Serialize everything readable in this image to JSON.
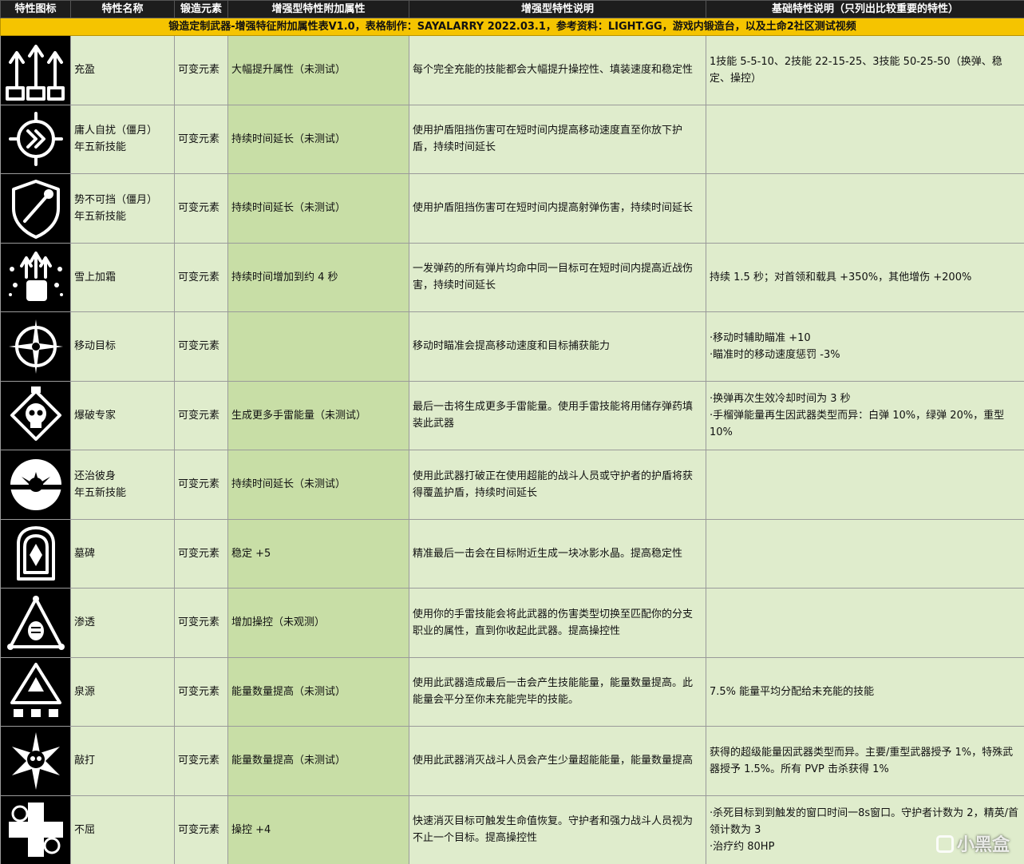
{
  "headers": [
    "特性图标",
    "特性名称",
    "锻造元素",
    "增强型特性附加属性",
    "增强型特性说明",
    "基础特性说明（只列出比较重要的特性）"
  ],
  "banner": "锻造定制武器-增强特征附加属性表V1.0，表格制作：SAYALARRY 2022.03.1，参考资料：LIGHT.GG，游戏内锻造台，以及土命2社区测试视频",
  "rows": [
    {
      "icon": "arrows-up-icon",
      "name": "充盈",
      "name2": "",
      "element": "可变元素",
      "attr": "大幅提升属性（未测试）",
      "desc": "每个完全充能的技能都会大幅提升操控性、填装速度和稳定性",
      "base": "1技能 5-5-10、2技能 22-15-25、3技能 50-25-50（换弹、稳定、操控）"
    },
    {
      "icon": "chevron-circle-icon",
      "name": "庸人自扰（僵月）",
      "name2": "年五新技能",
      "element": "可变元素",
      "attr": "持续时间延长（未测试）",
      "desc": "使用护盾阻挡伤害可在短时间内提高移动速度直至你放下护盾，持续时间延长",
      "base": ""
    },
    {
      "icon": "shield-comet-icon",
      "name": "势不可挡（僵月）",
      "name2": "年五新技能",
      "element": "可变元素",
      "attr": "持续时间延长（未测试）",
      "desc": "使用护盾阻挡伤害可在短时间内提高射弹伤害，持续时间延长",
      "base": ""
    },
    {
      "icon": "fist-arrows-icon",
      "name": "雪上加霜",
      "name2": "",
      "element": "可变元素",
      "attr": "持续时间增加到约 4 秒",
      "desc": "一发弹药的所有弹片均命中同一目标可在短时间内提高近战伤害，持续时间延长",
      "base": "持续 1.5 秒；对首领和载具 +350%，其他增伤 +200%"
    },
    {
      "icon": "crosshair-star-icon",
      "name": "移动目标",
      "name2": "",
      "element": "可变元素",
      "attr": "",
      "desc": "移动时瞄准会提高移动速度和目标捕获能力",
      "base": "·移动时辅助瞄准 +10\n·瞄准时的移动速度惩罚 -3%"
    },
    {
      "icon": "skull-diamond-icon",
      "name": "爆破专家",
      "name2": "",
      "element": "可变元素",
      "attr": "生成更多手雷能量（未测试）",
      "desc": "最后一击将生成更多手雷能量。使用手雷技能将用储存弹药填装此武器",
      "base": "·换弹再次生效冷却时间为 3 秒\n·手榴弹能量再生因武器类型而异：白弹 10%，绿弹 20%，重型 10%"
    },
    {
      "icon": "sun-burst-icon",
      "name": "还治彼身",
      "name2": "年五新技能",
      "element": "可变元素",
      "attr": "持续时间延长（未测试）",
      "desc": "使用此武器打破正在使用超能的战斗人员或守护者的护盾将获得覆盖护盾，持续时间延长",
      "base": ""
    },
    {
      "icon": "tombstone-icon",
      "name": "墓碑",
      "name2": "",
      "element": "可变元素",
      "attr": "稳定 +5",
      "desc": "精准最后一击会在目标附近生成一块冰影水晶。提高稳定性",
      "base": ""
    },
    {
      "icon": "triangle-grenade-icon",
      "name": "渗透",
      "name2": "",
      "element": "可变元素",
      "attr": "增加操控（未观测）",
      "desc": "使用你的手雷技能会将此武器的伤害类型切换至匹配你的分支职业的属性，直到你收起此武器。提高操控性",
      "base": ""
    },
    {
      "icon": "fountain-triangle-icon",
      "name": "泉源",
      "name2": "",
      "element": "可变元素",
      "attr": "能量数量提高（未测试）",
      "desc": "使用此武器造成最后一击会产生技能能量，能量数量提高。此能量会平分至你未充能完毕的技能。",
      "base": "7.5% 能量平均分配给未充能的技能"
    },
    {
      "icon": "skull-star-icon",
      "name": "敲打",
      "name2": "",
      "element": "可变元素",
      "attr": "能量数量提高（未测试）",
      "desc": "使用此武器消灭战斗人员会产生少量超能能量，能量数量提高",
      "base": "获得的超级能量因武器类型而异。主要/重型武器授予 1%，特殊武器授予 1.5%。所有 PVP 击杀获得 1%"
    },
    {
      "icon": "cross-gears-icon",
      "name": "不屈",
      "name2": "",
      "element": "可变元素",
      "attr": "操控 +4",
      "desc": "快速消灭目标可触发生命值恢复。守护者和强力战斗人员视为不止一个目标。提高操控性",
      "base": "·杀死目标到到触发的窗口时间一8s窗口。守护者计数为 2，精英/首领计数为 3\n·治疗约 80HP"
    }
  ],
  "watermark": "小黑盒"
}
